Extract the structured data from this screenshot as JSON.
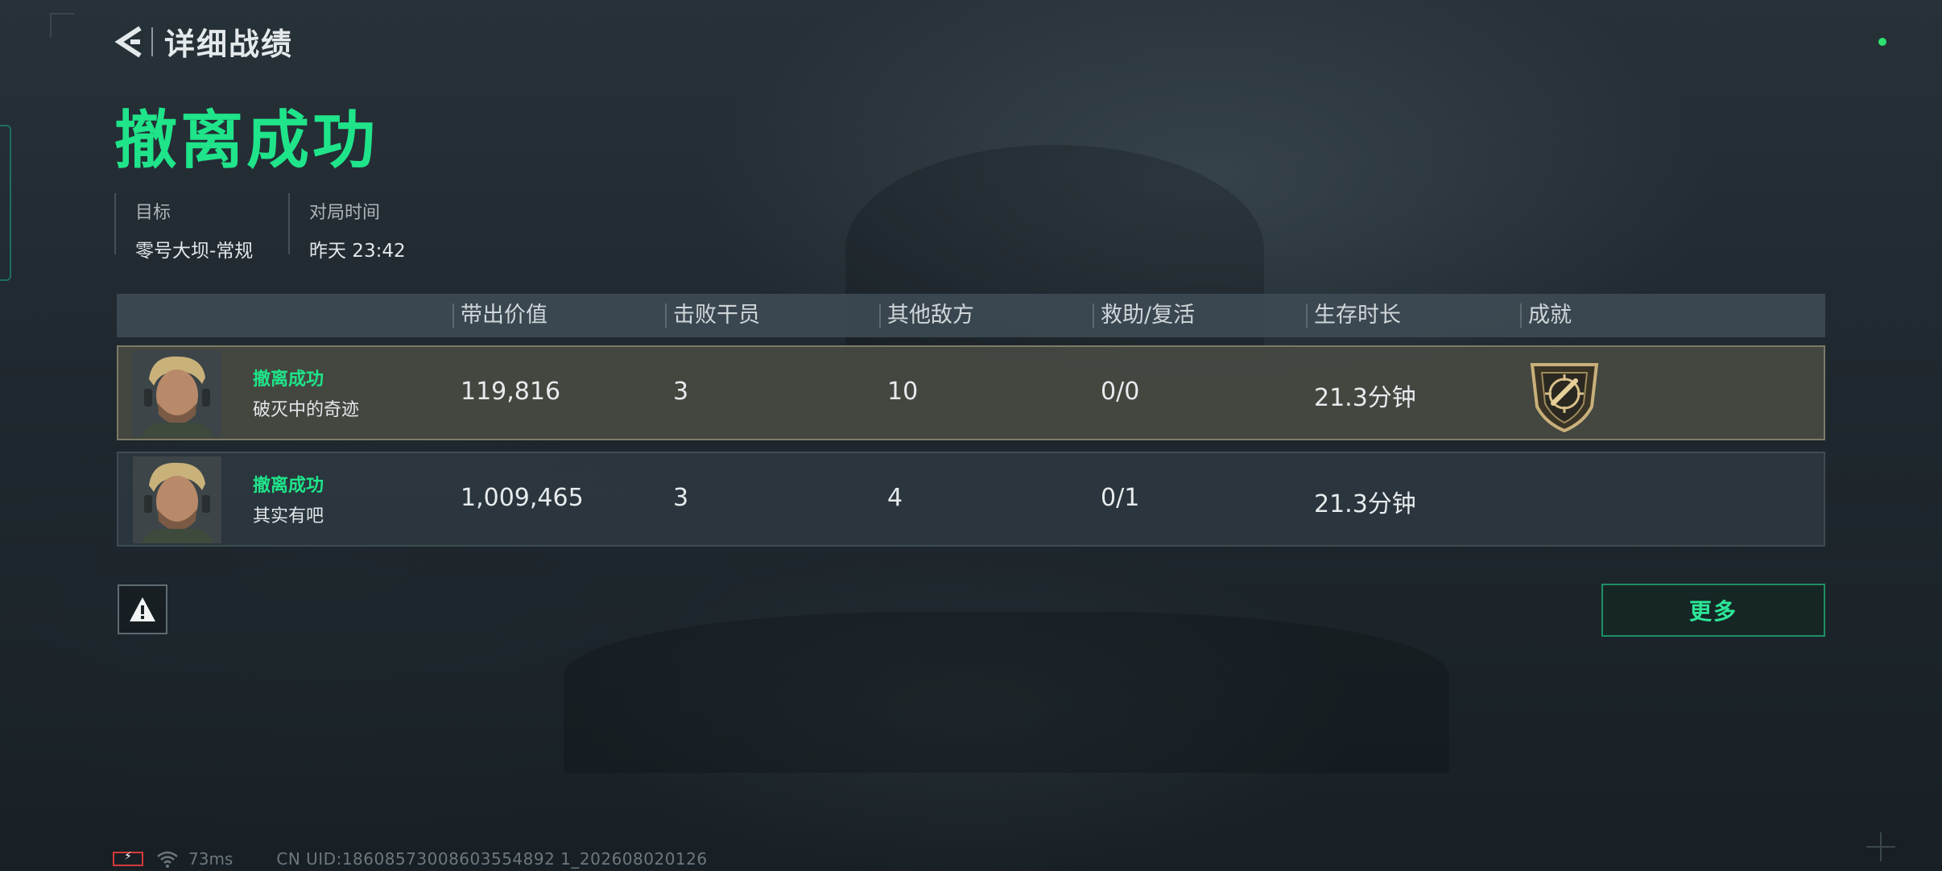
{
  "header": {
    "back_label": "详细战绩"
  },
  "result": {
    "title": "撤离成功",
    "color": "#1fe48a"
  },
  "info": {
    "target_label": "目标",
    "target_value": "零号大坝-常规",
    "time_label": "对局时间",
    "time_value": "昨天 23:42"
  },
  "table": {
    "headers": [
      "带出价值",
      "击败干员",
      "其他敌方",
      "救助/复活",
      "生存时长",
      "成就"
    ],
    "rows": [
      {
        "status": "撤离成功",
        "name": "破灭中的奇迹",
        "value": "119,816",
        "kills": "3",
        "others": "10",
        "assist": "0/0",
        "survival": "21.3分钟",
        "achievement_icon": "shield-badge-icon"
      },
      {
        "status": "撤离成功",
        "name": "其实有吧",
        "value": "1,009,465",
        "kills": "3",
        "others": "4",
        "assist": "0/1",
        "survival": "21.3分钟",
        "achievement_icon": ""
      }
    ]
  },
  "actions": {
    "more_label": "更多",
    "report_icon": "warning-icon"
  },
  "footer": {
    "ping": "73ms",
    "uid": "CN UID:18608573008603554892 1_202608020126",
    "battery_icon": "battery-low-icon",
    "wifi_icon": "wifi-icon"
  },
  "colors": {
    "accent": "#1fe48a",
    "highlight_border": "#7c7a68",
    "status_dot": "#2ee06e"
  }
}
